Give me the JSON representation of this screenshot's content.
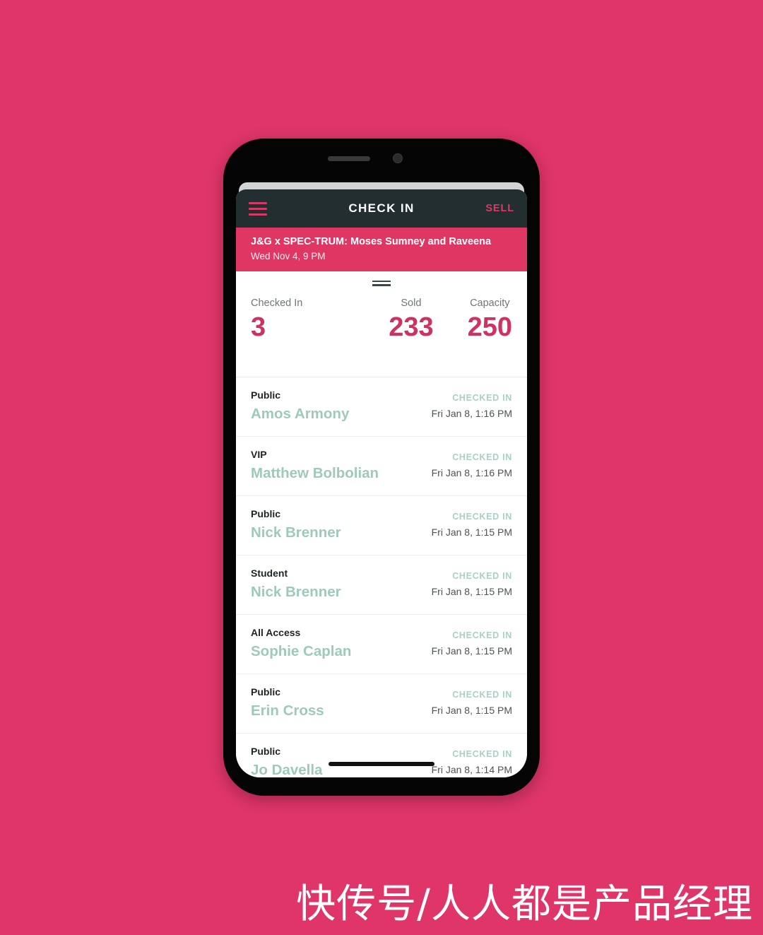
{
  "background_color": "#df3569",
  "device": {
    "speaker_icon": "speaker-grille-icon",
    "camera_icon": "front-camera-icon"
  },
  "app_bar": {
    "menu_icon": "hamburger-menu-icon",
    "title": "CHECK IN",
    "sell_label": "SELL",
    "background_color": "#232e31",
    "accent_color": "#d33b65"
  },
  "event_banner": {
    "title": "J&G x SPEC-TRUM: Moses Sumney and Raveena",
    "datetime": "Wed Nov 4, 9 PM",
    "background_color": "#e03663"
  },
  "stats": {
    "drag_handle_icon": "drag-handle-icon",
    "checked_in": {
      "label": "Checked In",
      "value": "3"
    },
    "sold": {
      "label": "Sold",
      "value": "233"
    },
    "capacity": {
      "label": "Capacity",
      "value": "250"
    },
    "value_color": "#ce3360"
  },
  "attendees": [
    {
      "ticket_type": "Public",
      "name": "Amos Armony",
      "status": "CHECKED IN",
      "time": "Fri Jan 8, 1:16 PM"
    },
    {
      "ticket_type": "VIP",
      "name": "Matthew Bolbolian",
      "status": "CHECKED IN",
      "time": "Fri Jan 8, 1:16 PM"
    },
    {
      "ticket_type": "Public",
      "name": "Nick Brenner",
      "status": "CHECKED IN",
      "time": "Fri Jan 8, 1:15 PM"
    },
    {
      "ticket_type": "Student",
      "name": "Nick Brenner",
      "status": "CHECKED IN",
      "time": "Fri Jan 8, 1:15 PM"
    },
    {
      "ticket_type": "All Access",
      "name": "Sophie Caplan",
      "status": "CHECKED IN",
      "time": "Fri Jan 8, 1:15 PM"
    },
    {
      "ticket_type": "Public",
      "name": "Erin Cross",
      "status": "CHECKED IN",
      "time": "Fri Jan 8, 1:15 PM"
    },
    {
      "ticket_type": "Public",
      "name": "Jo Davella",
      "status": "CHECKED IN",
      "time": "Fri Jan 8, 1:14 PM"
    }
  ],
  "name_color": "#9ec9bd",
  "status_color": "#a9d0c5",
  "watermark": "快传号/人人都是产品经理"
}
